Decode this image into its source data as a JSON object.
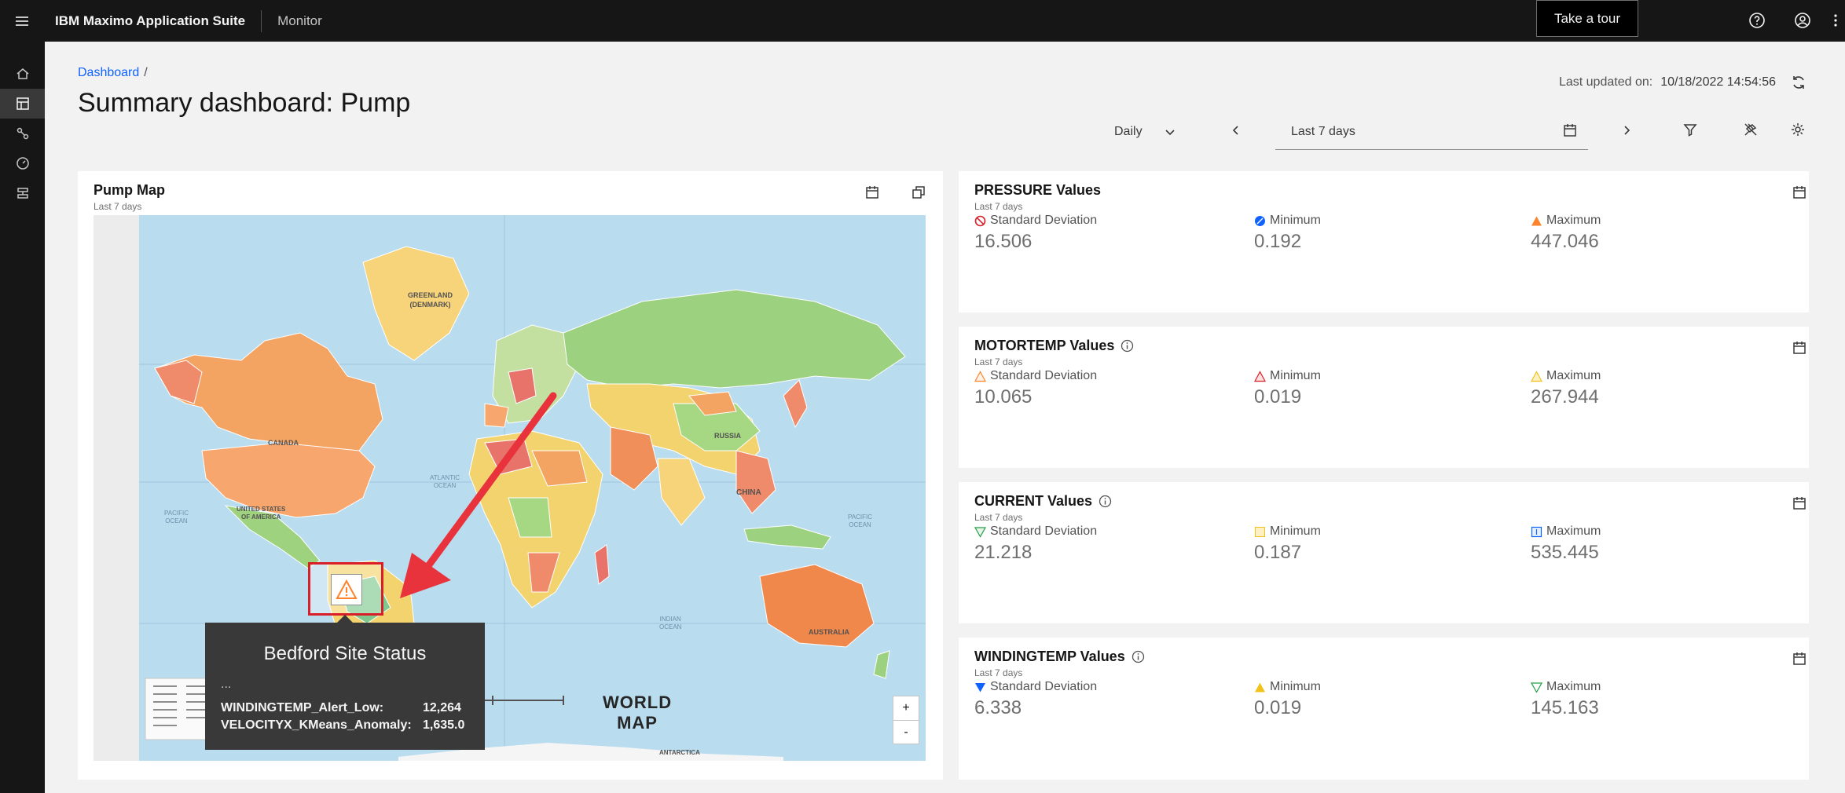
{
  "topbar": {
    "brand": "IBM Maximo Application Suite",
    "app": "Monitor",
    "tour_button": "Take a tour"
  },
  "header": {
    "breadcrumb": "Dashboard",
    "breadcrumb_sep": "/",
    "title": "Summary dashboard: Pump",
    "last_updated_label": "Last updated on:",
    "last_updated_value": "10/18/2022 14:54:56"
  },
  "toolbar": {
    "interval": "Daily",
    "date_range": "Last 7 days"
  },
  "map_card": {
    "title": "Pump Map",
    "subtitle": "Last 7 days",
    "zoom_in": "+",
    "zoom_out": "-",
    "tooltip": {
      "title": "Bedford Site Status",
      "more": "...",
      "rows": [
        {
          "key": "WINDINGTEMP_Alert_Low:",
          "value": "12,264"
        },
        {
          "key": "VELOCITYX_KMeans_Anomaly:",
          "value": "1,635.0"
        }
      ]
    },
    "map_labels": {
      "world": "WORLD",
      "map": "MAP",
      "greenland": "GREENLAND",
      "greenland_sub": "(DENMARK)",
      "canada": "CANADA",
      "usa": "UNITED STATES",
      "usa_sub": "OF AMERICA",
      "russia": "RUSSIA",
      "china": "CHINA",
      "australia": "AUSTRALIA",
      "antarctica": "ANTARCTICA",
      "atlantic": "ATLANTIC",
      "pacific": "PACIFIC",
      "ocean": "OCEAN",
      "indian": "INDIAN"
    }
  },
  "metric_cards": [
    {
      "title": "PRESSURE Values",
      "subtitle": "Last 7 days",
      "has_info": false,
      "metrics": [
        {
          "label": "Standard Deviation",
          "value": "16.506",
          "icon": "prohibited-icon",
          "color": "#da1e28"
        },
        {
          "label": "Minimum",
          "value": "0.192",
          "icon": "blue-circle-icon",
          "color": "#0f62fe"
        },
        {
          "label": "Maximum",
          "value": "447.046",
          "icon": "orange-triangle-icon",
          "color": "#ff832b"
        }
      ]
    },
    {
      "title": "MOTORTEMP Values",
      "subtitle": "Last 7 days",
      "has_info": true,
      "metrics": [
        {
          "label": "Standard Deviation",
          "value": "10.065",
          "icon": "orange-triangle-outline-icon",
          "color": "#ff832b"
        },
        {
          "label": "Minimum",
          "value": "0.019",
          "icon": "red-triangle-outline-icon",
          "color": "#da1e28"
        },
        {
          "label": "Maximum",
          "value": "267.944",
          "icon": "yellow-triangle-outline-icon",
          "color": "#f1c21b"
        }
      ]
    },
    {
      "title": "CURRENT Values",
      "subtitle": "Last 7 days",
      "has_info": true,
      "metrics": [
        {
          "label": "Standard Deviation",
          "value": "21.218",
          "icon": "green-triangle-down-icon",
          "color": "#24a148"
        },
        {
          "label": "Minimum",
          "value": "0.187",
          "icon": "yellow-square-icon",
          "color": "#f1c21b"
        },
        {
          "label": "Maximum",
          "value": "535.445",
          "icon": "blue-square-icon",
          "color": "#0f62fe"
        }
      ]
    },
    {
      "title": "WINDINGTEMP Values",
      "subtitle": "Last 7 days",
      "has_info": true,
      "metrics": [
        {
          "label": "Standard Deviation",
          "value": "6.338",
          "icon": "blue-triangle-down-icon",
          "color": "#0f62fe"
        },
        {
          "label": "Minimum",
          "value": "0.019",
          "icon": "yellow-triangle-icon",
          "color": "#f1c21b"
        },
        {
          "label": "Maximum",
          "value": "145.163",
          "icon": "green-triangle-down-outline-icon",
          "color": "#24a148"
        }
      ]
    }
  ]
}
